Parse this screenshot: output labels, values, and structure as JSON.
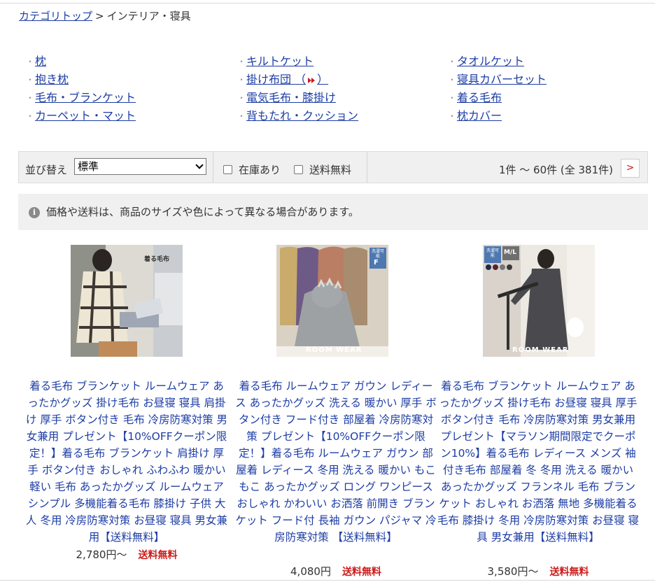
{
  "breadcrumb": {
    "top_link": "カテゴリトップ",
    "separator": ">",
    "current": "インテリア・寝具"
  },
  "categories": {
    "bullet": "・",
    "col1": [
      "枕",
      "抱き枕",
      "毛布・ブランケット",
      "カーペット・マット"
    ],
    "col2": [
      "キルトケット",
      "掛け布団",
      "電気毛布・膝掛け",
      "背もたれ・クッション"
    ],
    "col2_new_open": "（",
    "col2_new_close": "）",
    "col3": [
      "タオルケット",
      "寝具カバーセット",
      "着る毛布",
      "枕カバー"
    ]
  },
  "sortbar": {
    "sort_label": "並び替え",
    "sort_selected": "標準",
    "in_stock_label": "在庫あり",
    "free_shipping_label": "送料無料",
    "count_text": "1件 〜 60件 (全 381件)",
    "next_label": ">"
  },
  "notice": {
    "icon_letter": "i",
    "text": "価格や送料は、商品のサイズや色によって異なる場合があります。"
  },
  "products": [
    {
      "title": "着る毛布 ブランケット ルームウェア あったかグッズ 掛け毛布 お昼寝 寝具 肩掛け 厚手 ボタン付き 毛布 冷房防寒対策 男女兼用 プレゼント【10%OFFクーポン限定！】着る毛布 ブランケット 肩掛け 厚手 ボタン付き おしゃれ ふわふわ 暖かい 軽い 毛布 あったかグッズ ルームウェア シンプル 多機能着る毛布 膝掛け 子供 大人 冬用 冷房防寒対策 お昼寝 寝具 男女兼用【送料無料】",
      "price": "2,780円〜",
      "shipping": "送料無料",
      "image_text": "着る毛布"
    },
    {
      "title": "着る毛布 ルームウェア ガウン レディース あったかグッズ 洗える 暖かい 厚手 ボタン付き フード付き 部屋着 冷房防寒対策 プレゼント【10%OFFクーポン限定！】着る毛布 ルームウェア ガウン 部屋着 レディース 冬用 洗える 暖かい もこもこ あったかグッズ ロング ワンピース おしゃれ かわいい お洒落 前開き ブランケット フード付 長袖 ガウン パジャマ 冷房防寒対策 【送料無料】",
      "price": "4,080円",
      "shipping": "送料無料",
      "image_badge_top": "洗濯可能",
      "image_badge_letter": "F",
      "image_caption": "ROOM WEAR"
    },
    {
      "title": "着る毛布 ブランケット ルームウェア あったかグッズ 掛け毛布 お昼寝 寝具 厚手 ボタン付き 毛布 冷房防寒対策 男女兼用 プレゼント【マラソン期間限定でクーポン10%】着る毛布 レディース メンズ 袖付き毛布 部屋着 冬 冬用 洗える 暖かい あったかグッズ フランネル 毛布 ブランケット おしゃれ お洒落 無地 多機能着る毛布 膝掛け 冬用 冷房防寒対策 お昼寝 寝具 男女兼用【送料無料】",
      "price": "3,580円〜",
      "shipping": "送料無料",
      "image_badge_top": "洗濯可能",
      "image_badge_size": "M/L",
      "image_caption": "ROOM WEAR"
    }
  ],
  "colors": {
    "link": "#1d3da5",
    "shipping_red": "#cc1b1b",
    "bar_bg": "#f0f0f0"
  }
}
